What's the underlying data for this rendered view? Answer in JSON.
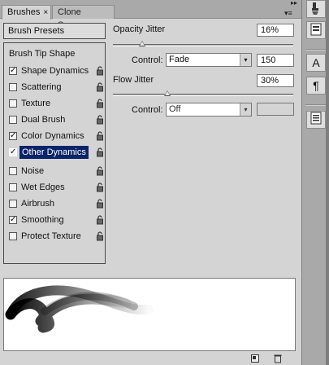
{
  "tabs": [
    {
      "label": "Brushes",
      "close": "×"
    },
    {
      "label": "Clone Source"
    }
  ],
  "panel_controls": {
    "collapse": "▸▸",
    "menu": "▾≡"
  },
  "brush_presets_label": "Brush Presets",
  "brush_tip_shape_label": "Brush Tip Shape",
  "options": [
    {
      "label": "Shape Dynamics",
      "checked": true
    },
    {
      "label": "Scattering",
      "checked": false
    },
    {
      "label": "Texture",
      "checked": false
    },
    {
      "label": "Dual Brush",
      "checked": false
    },
    {
      "label": "Color Dynamics",
      "checked": true
    },
    {
      "label": "Other Dynamics",
      "checked": true,
      "selected": true
    },
    {
      "label": "Noise",
      "checked": false
    },
    {
      "label": "Wet Edges",
      "checked": false
    },
    {
      "label": "Airbrush",
      "checked": false
    },
    {
      "label": "Smoothing",
      "checked": true
    },
    {
      "label": "Protect Texture",
      "checked": false
    }
  ],
  "opacity_jitter": {
    "label": "Opacity Jitter",
    "value": "16%",
    "slider_fraction": 0.16,
    "control_label": "Control:",
    "control_value": "Fade",
    "steps": "150"
  },
  "flow_jitter": {
    "label": "Flow Jitter",
    "value": "30%",
    "slider_fraction": 0.3,
    "control_label": "Control:",
    "control_value": "Off",
    "steps": ""
  },
  "check_mark": "✓",
  "dropdown_arrow": "▾",
  "dock": {
    "buttons": [
      "brush-icon",
      "clone-stamp-icon",
      "character-icon",
      "paragraph-icon",
      "notes-icon"
    ],
    "character_glyph": "A",
    "paragraph_glyph": "¶"
  },
  "colors": {
    "selection": "#0a246a",
    "panel": "#d4d4d4",
    "tabbar": "#a9a9a9"
  }
}
